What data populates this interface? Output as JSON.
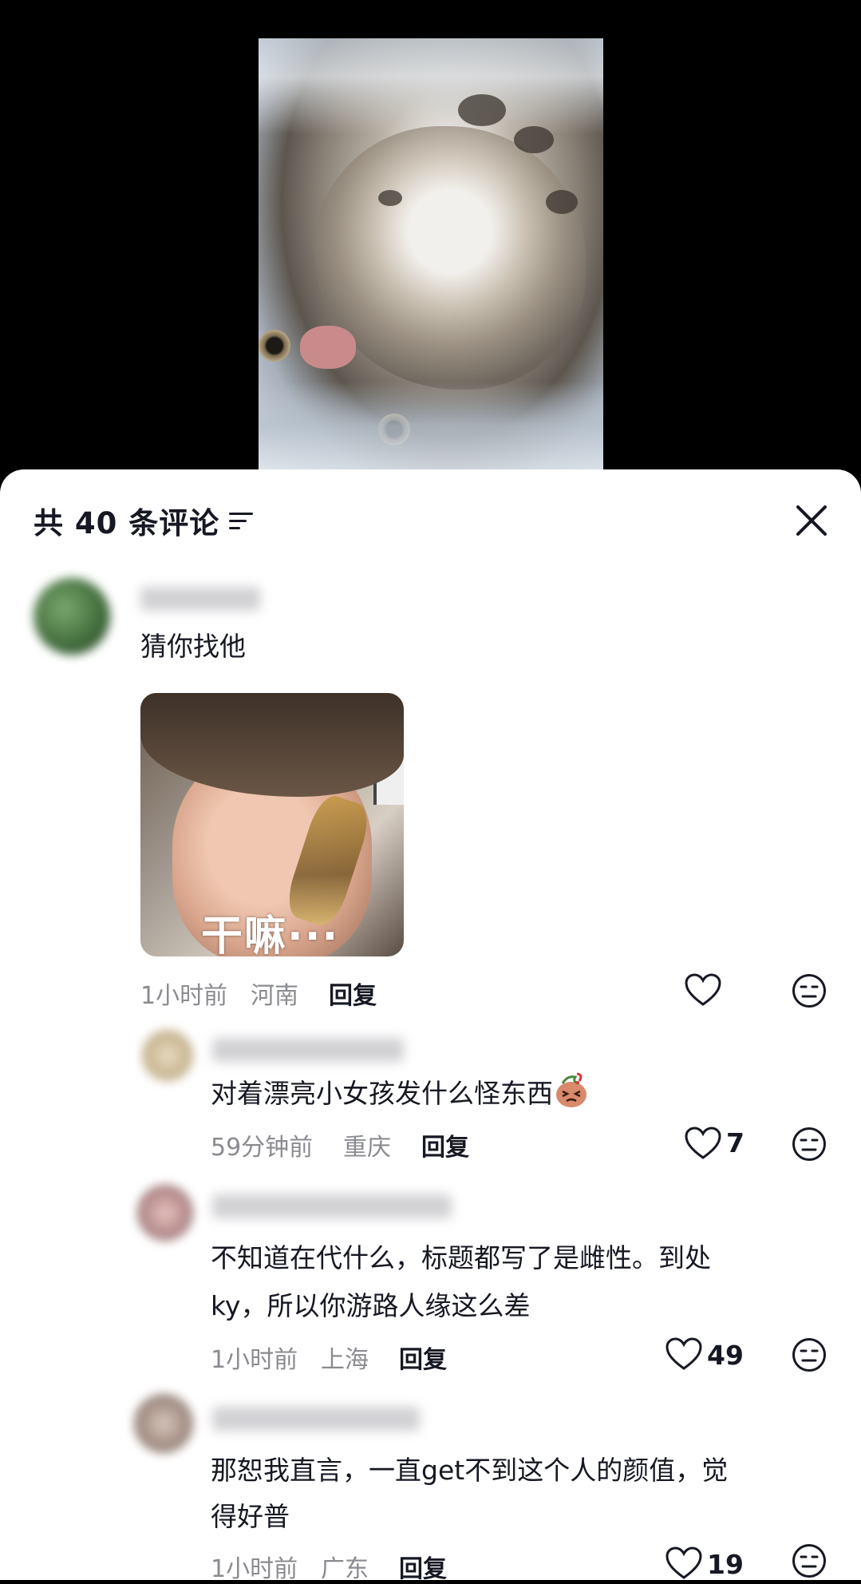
{
  "sheet": {
    "title": "共 40 条评论"
  },
  "comments": [
    {
      "text": "猜你找他",
      "image_caption": "干嘛···",
      "time": "1小时前",
      "location": "河南",
      "reply_label": "回复",
      "likes": ""
    },
    {
      "text": "对着漂亮小女孩发什么怪东西",
      "time": "59分钟前",
      "location": "重庆",
      "reply_label": "回复",
      "likes": "7"
    },
    {
      "text_line1": "不知道在代什么，标题都写了是雌性。到处",
      "text_line2": "ky，所以你游路人缘这么差",
      "time": "1小时前",
      "location": "上海",
      "reply_label": "回复",
      "likes": "49"
    },
    {
      "text_line1": "那恕我直言，一直get不到这个人的颜值，觉",
      "text_line2": "得好普",
      "time": "1小时前",
      "location": "广东",
      "reply_label": "回复",
      "likes": "19"
    }
  ]
}
